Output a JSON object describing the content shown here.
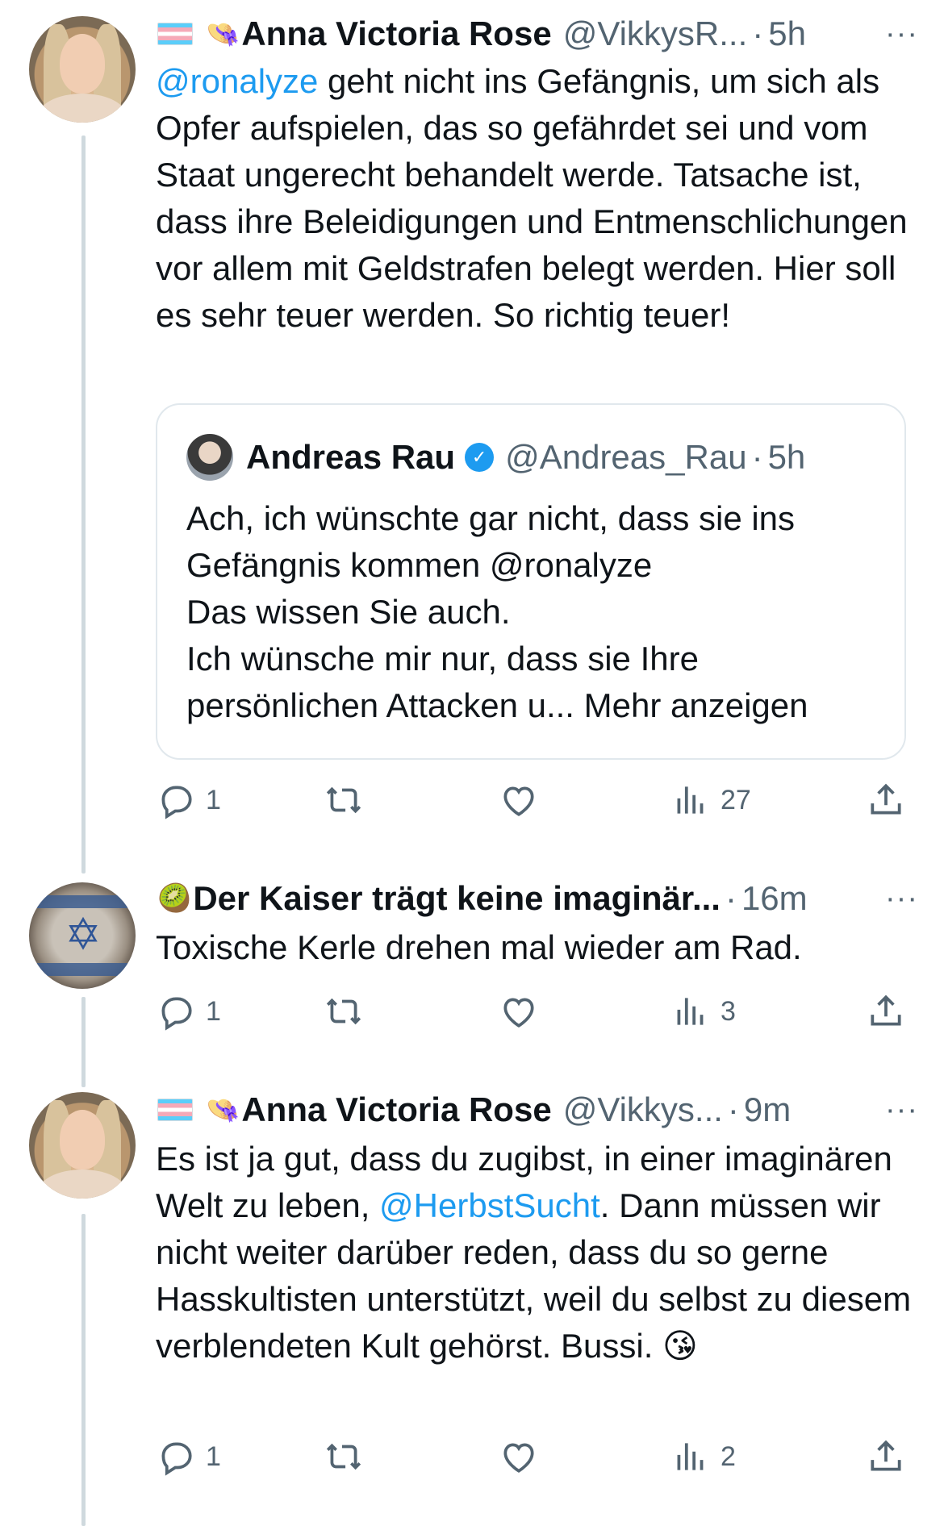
{
  "tweets": [
    {
      "name": "Anna Victoria Rose",
      "handle": "@VikkysR...",
      "time": "5h",
      "body_mention": "@ronalyze",
      "body_text": " geht nicht ins Gefängnis, um sich als Opfer aufspielen, das so gefährdet sei und vom Staat ungerecht behandelt werde. Tatsache ist, dass ihre Beleidigungen und Entmenschlichungen vor allem mit Geldstrafen belegt werden. Hier soll es sehr teuer werden. So richtig teuer!",
      "quote": {
        "name": "Andreas Rau",
        "handle": "@Andreas_Rau",
        "time": "5h",
        "lines": [
          "Ach, ich wünschte gar nicht, dass sie ins",
          "Gefängnis kommen @ronalyze",
          "Das wissen Sie auch.",
          "Ich wünsche mir nur, dass sie Ihre",
          "persönlichen Attacken u... Mehr anzeigen"
        ]
      },
      "replies": "1",
      "views": "27"
    },
    {
      "name": "Der Kaiser trägt keine imaginär...",
      "time": "16m",
      "body_text": "Toxische Kerle drehen mal wieder am Rad.",
      "replies": "1",
      "views": "3"
    },
    {
      "name": "Anna Victoria Rose",
      "handle": "@Vikkys...",
      "time": "9m",
      "body_pre": "Es ist ja gut, dass du zugibst, in einer imaginären Welt zu leben, ",
      "body_mention": "@HerbstSucht",
      "body_post": ". Dann müssen wir nicht weiter darüber reden, dass du so gerne Hasskultisten unterstützt, weil du selbst zu diesem verblendeten Kult gehörst. Bussi. 😘",
      "replies": "1",
      "views": "2"
    }
  ],
  "ui": {
    "dot": "·",
    "more": "···",
    "kiwi": "🥝",
    "hat": "👒"
  },
  "colors": {
    "accent": "#1d9bf0",
    "muted": "#536471",
    "text": "#0f1419",
    "line": "#cfd9de"
  }
}
